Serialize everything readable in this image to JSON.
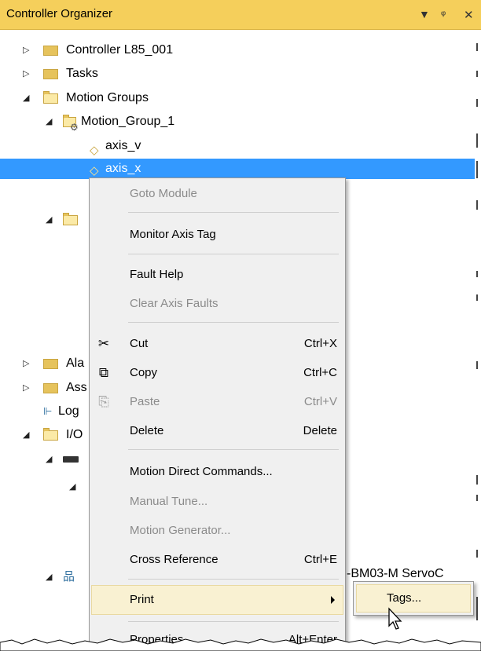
{
  "window": {
    "title": "Controller Organizer",
    "controls": {
      "dropdown": "▾",
      "pin": "ᵖ",
      "close": "✕"
    }
  },
  "tree": {
    "items": [
      {
        "label": "Controller L85_001"
      },
      {
        "label": "Tasks"
      },
      {
        "label": "Motion Groups"
      },
      {
        "label": "Motion_Group_1"
      },
      {
        "label": "axis_v"
      },
      {
        "label": "axis_x"
      },
      {
        "label": "Ala"
      },
      {
        "label": "Ass"
      },
      {
        "label": "Log"
      },
      {
        "label": "I/O"
      }
    ],
    "overflow_text": "-BM03-M ServoC"
  },
  "context_menu": {
    "items": [
      {
        "label": "Goto Module",
        "disabled": true
      },
      {
        "label": "Monitor Axis Tag"
      },
      {
        "label": "Fault Help"
      },
      {
        "label": "Clear Axis Faults",
        "disabled": true
      },
      {
        "label": "Cut",
        "shortcut": "Ctrl+X",
        "icon": "cut-icon"
      },
      {
        "label": "Copy",
        "shortcut": "Ctrl+C",
        "icon": "copy-icon"
      },
      {
        "label": "Paste",
        "shortcut": "Ctrl+V",
        "icon": "paste-icon",
        "disabled": true
      },
      {
        "label": "Delete",
        "shortcut": "Delete"
      },
      {
        "label": "Motion Direct Commands..."
      },
      {
        "label": "Manual Tune...",
        "disabled": true
      },
      {
        "label": "Motion Generator...",
        "disabled": true
      },
      {
        "label": "Cross Reference",
        "shortcut": "Ctrl+E"
      },
      {
        "label": "Print"
      },
      {
        "label": "Properties",
        "shortcut": "Alt+Enter"
      }
    ]
  },
  "submenu": {
    "items": [
      {
        "label": "Tags..."
      }
    ]
  },
  "colors": {
    "titlebar": "#f5cf5b",
    "selection": "#3399ff",
    "menu_bg": "#f0f0f0",
    "menu_hover": "#f9f1d2"
  }
}
